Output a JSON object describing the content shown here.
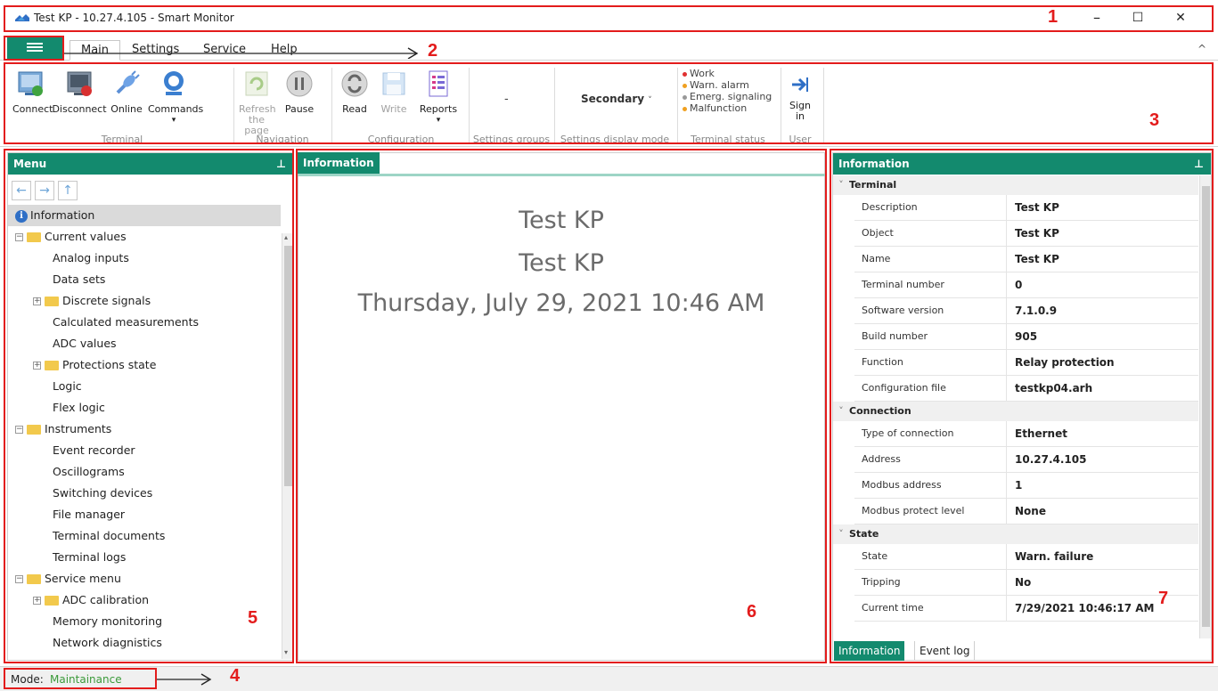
{
  "window": {
    "title": "Test KP - 10.27.4.105 - Smart Monitor",
    "minimize": "–",
    "maximize": "☐",
    "close": "✕"
  },
  "menubar": {
    "tabs": [
      {
        "label": "Main",
        "active": true
      },
      {
        "label": "Settings"
      },
      {
        "label": "Service"
      },
      {
        "label": "Help"
      }
    ],
    "collapse": "^"
  },
  "ribbon": {
    "terminal": {
      "group_label": "Terminal",
      "buttons": [
        "Connect",
        "Disconnect",
        "Online",
        "Commands"
      ]
    },
    "navigation": {
      "group_label": "Navigation",
      "buttons": [
        "Refresh\nthe page",
        "Pause"
      ]
    },
    "configuration": {
      "group_label": "Configuration",
      "buttons": [
        "Read",
        "Write",
        "Reports"
      ]
    },
    "settings_groups": {
      "group_label": "Settings groups",
      "value": "-"
    },
    "settings_display_mode": {
      "group_label": "Settings display mode",
      "value": "Secondary"
    },
    "terminal_status": {
      "group_label": "Terminal status",
      "items": [
        {
          "label": "Work",
          "color": "#e03030"
        },
        {
          "label": "Warn. alarm",
          "color": "#f0a020"
        },
        {
          "label": "Emerg. signaling",
          "color": "#999999"
        },
        {
          "label": "Malfunction",
          "color": "#f0a020"
        }
      ]
    },
    "user": {
      "group_label": "User",
      "sign_in": "Sign\nin"
    }
  },
  "menu_panel": {
    "title": "Menu",
    "pin": "⌂",
    "nav": [
      "←",
      "→",
      "↑"
    ],
    "items": [
      {
        "label": "Information",
        "type": "info",
        "indent": 0,
        "selected": true
      },
      {
        "label": "Current values",
        "type": "folder",
        "indent": 0,
        "expander": "−"
      },
      {
        "label": "Analog inputs",
        "type": "leaf",
        "indent": 2
      },
      {
        "label": "Data sets",
        "type": "leaf",
        "indent": 2
      },
      {
        "label": "Discrete signals",
        "type": "folder",
        "indent": 1,
        "expander": "+"
      },
      {
        "label": "Calculated measurements",
        "type": "leaf",
        "indent": 2
      },
      {
        "label": "ADC values",
        "type": "leaf",
        "indent": 2
      },
      {
        "label": "Protections state",
        "type": "folder",
        "indent": 1,
        "expander": "+"
      },
      {
        "label": "Logic",
        "type": "leaf",
        "indent": 2
      },
      {
        "label": "Flex logic",
        "type": "leaf",
        "indent": 2
      },
      {
        "label": "Instruments",
        "type": "folder",
        "indent": 0,
        "expander": "−"
      },
      {
        "label": "Event recorder",
        "type": "leaf",
        "indent": 2
      },
      {
        "label": "Oscillograms",
        "type": "leaf",
        "indent": 2
      },
      {
        "label": "Switching devices",
        "type": "leaf",
        "indent": 2
      },
      {
        "label": "File manager",
        "type": "leaf",
        "indent": 2
      },
      {
        "label": "Terminal documents",
        "type": "leaf",
        "indent": 2
      },
      {
        "label": "Terminal logs",
        "type": "leaf",
        "indent": 2
      },
      {
        "label": "Service menu",
        "type": "folder",
        "indent": 0,
        "expander": "−"
      },
      {
        "label": "ADC calibration",
        "type": "folder",
        "indent": 1,
        "expander": "+"
      },
      {
        "label": "Memory monitoring",
        "type": "leaf",
        "indent": 2
      },
      {
        "label": "Network diagnistics",
        "type": "leaf",
        "indent": 2
      }
    ]
  },
  "center_panel": {
    "tab": "Information",
    "line1": "Test KP",
    "line2": "Test KP",
    "line3": "Thursday, July 29, 2021 10:46 AM"
  },
  "info_panel": {
    "title": "Information",
    "pin": "⌂",
    "sections": [
      {
        "name": "Terminal",
        "rows": [
          {
            "k": "Description",
            "v": "Test KP"
          },
          {
            "k": "Object",
            "v": "Test KP"
          },
          {
            "k": "Name",
            "v": "Test KP"
          },
          {
            "k": "Terminal number",
            "v": "0"
          },
          {
            "k": "Software version",
            "v": "7.1.0.9"
          },
          {
            "k": "Build number",
            "v": "905"
          },
          {
            "k": "Function",
            "v": "Relay protection"
          },
          {
            "k": "Configuration file",
            "v": "testkp04.arh"
          }
        ]
      },
      {
        "name": "Connection",
        "rows": [
          {
            "k": "Type of connection",
            "v": "Ethernet"
          },
          {
            "k": "Address",
            "v": "10.27.4.105"
          },
          {
            "k": "Modbus address",
            "v": "1"
          },
          {
            "k": "Modbus protect level",
            "v": "None"
          }
        ]
      },
      {
        "name": "State",
        "rows": [
          {
            "k": "State",
            "v": "Warn. failure"
          },
          {
            "k": "Tripping",
            "v": "No"
          },
          {
            "k": "Current time",
            "v": "7/29/2021 10:46:17 AM"
          }
        ]
      }
    ],
    "bottom_tabs": [
      {
        "label": "Information",
        "active": true
      },
      {
        "label": "Event log"
      }
    ]
  },
  "statusbar": {
    "mode_label": "Mode:",
    "mode_value": "Maintainance"
  },
  "annotations": [
    "1",
    "2",
    "3",
    "4",
    "5",
    "6",
    "7"
  ],
  "colors": {
    "accent": "#138a6e",
    "annotation": "#e31c1c"
  }
}
